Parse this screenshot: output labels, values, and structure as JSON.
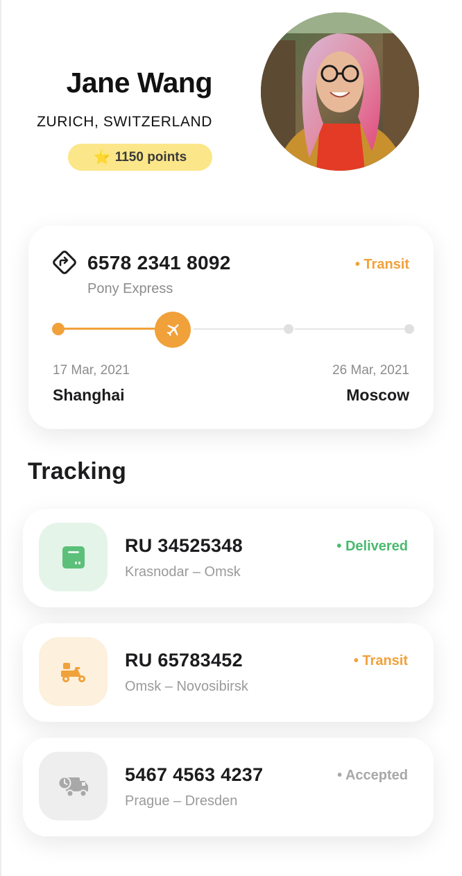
{
  "profile": {
    "name": "Jane Wang",
    "location": "ZURICH, SWITZERLAND",
    "points": "1150 points",
    "points_icon": "star-icon"
  },
  "shipment": {
    "number": "6578 2341 8092",
    "carrier": "Pony Express",
    "status": "• Transit",
    "status_color": "#f1a13a",
    "from_date": "17 Mar, 2021",
    "to_date": "26 Mar, 2021",
    "from_city": "Shanghai",
    "to_city": "Moscow",
    "progress_icon": "airplane-icon"
  },
  "section_title": "Tracking",
  "tracking": [
    {
      "number": "RU 34525348",
      "route": "Krasnodar – Omsk",
      "status": "• Delivered",
      "status_color": "#4bb96e",
      "icon": "box-icon"
    },
    {
      "number": "RU 65783452",
      "route": "Omsk – Novosibirsk",
      "status": "• Transit",
      "status_color": "#f1a13a",
      "icon": "scooter-icon"
    },
    {
      "number": "5467 4563 4237",
      "route": "Prague – Dresden",
      "status": "• Accepted",
      "status_color": "#a8a8a8",
      "icon": "delivery-truck-icon"
    }
  ],
  "colors": {
    "accent": "#f1a13a",
    "success": "#4bb96e",
    "muted": "#a8a8a8",
    "points_badge": "#fbe689"
  }
}
